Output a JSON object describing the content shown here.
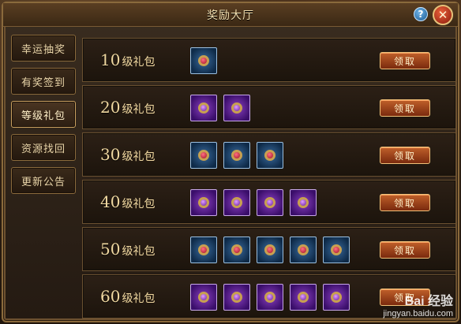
{
  "window": {
    "title": "奖励大厅"
  },
  "header": {
    "help_label": "?",
    "close_label": "✕"
  },
  "sidebar": {
    "items": [
      {
        "label": "幸运抽奖",
        "active": false
      },
      {
        "label": "有奖签到",
        "active": false
      },
      {
        "label": "等级礼包",
        "active": true
      },
      {
        "label": "资源找回",
        "active": false
      },
      {
        "label": "更新公告",
        "active": false
      }
    ]
  },
  "rewards": {
    "suffix": "级礼包",
    "claim_label": "领取",
    "rows": [
      {
        "level": "10",
        "items": [
          "ruby-ring"
        ]
      },
      {
        "level": "20",
        "items": [
          "amethyst-ring",
          "amethyst-ring"
        ]
      },
      {
        "level": "30",
        "items": [
          "ruby-ring",
          "ruby-ring",
          "ruby-ring"
        ]
      },
      {
        "level": "40",
        "items": [
          "amethyst-ring",
          "amethyst-ring",
          "amethyst-ring",
          "amethyst-ring"
        ]
      },
      {
        "level": "50",
        "items": [
          "ruby-ring",
          "ruby-ring",
          "ruby-ring",
          "ruby-ring",
          "ruby-ring"
        ]
      },
      {
        "level": "60",
        "items": [
          "amethyst-ring",
          "amethyst-ring",
          "amethyst-ring",
          "amethyst-ring",
          "amethyst-ring"
        ]
      }
    ]
  },
  "watermark": {
    "line1": "Bai 经验",
    "line2": "jingyan.baidu.com"
  }
}
